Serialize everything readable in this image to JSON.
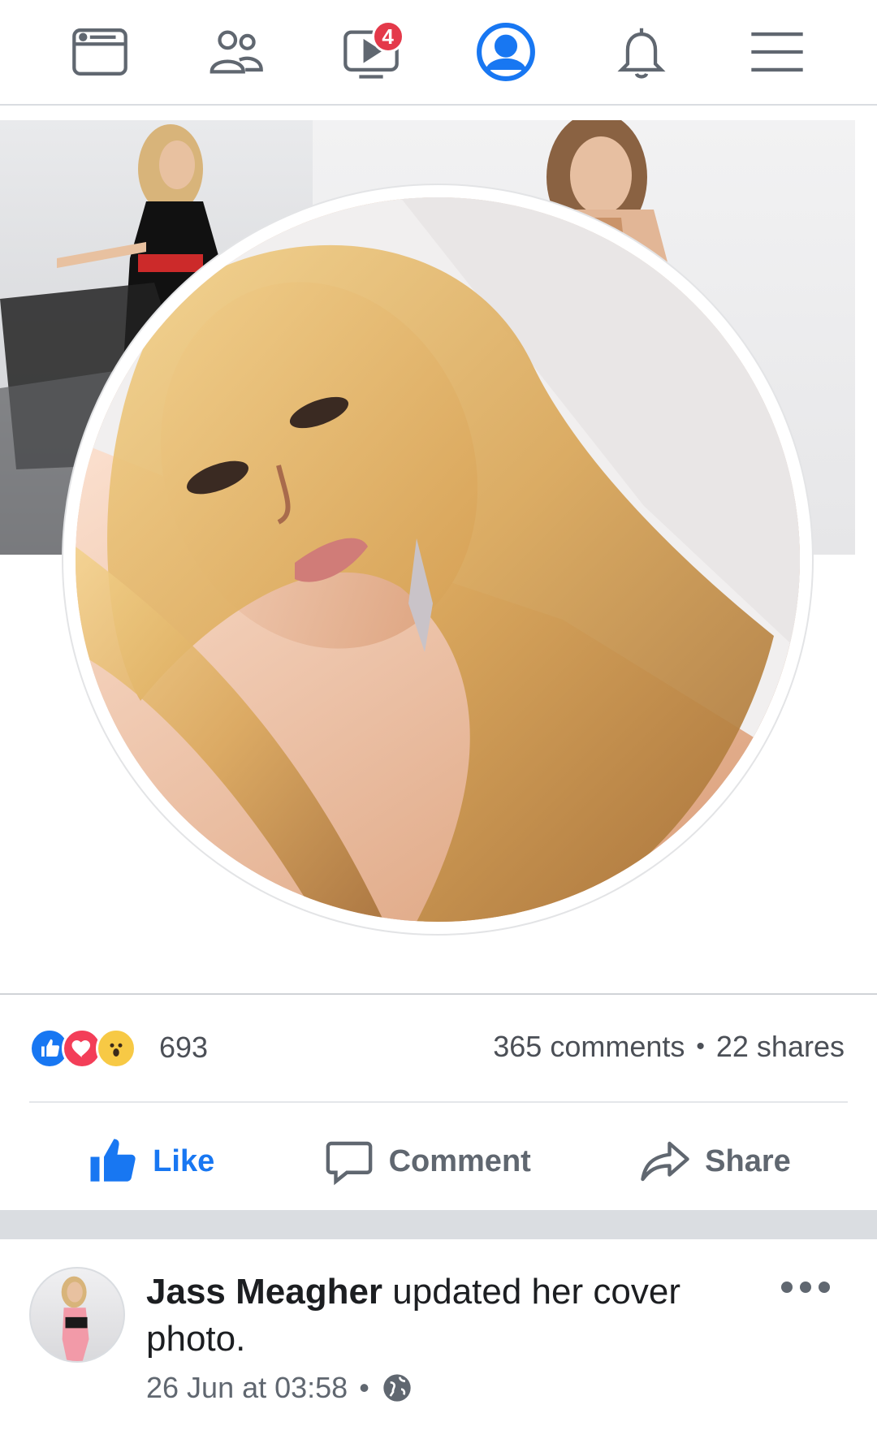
{
  "nav": {
    "items": [
      {
        "name": "news-feed",
        "icon": "news-feed-icon"
      },
      {
        "name": "friends",
        "icon": "friends-icon"
      },
      {
        "name": "watch",
        "icon": "video-icon",
        "badge": "4"
      },
      {
        "name": "profile",
        "icon": "profile-icon",
        "active": true
      },
      {
        "name": "notifications",
        "icon": "bell-icon"
      },
      {
        "name": "menu",
        "icon": "hamburger-menu-icon"
      }
    ],
    "active_color": "#1877f2",
    "badge_color": "#e4394a"
  },
  "reactions": {
    "icons": [
      "like-reaction-icon",
      "love-reaction-icon",
      "wow-reaction-icon"
    ],
    "count": "693"
  },
  "stats": {
    "comments": "365 comments",
    "separator": "•",
    "shares": "22 shares"
  },
  "actions": {
    "like": "Like",
    "comment": "Comment",
    "share": "Share"
  },
  "post": {
    "author": "Jass Meagher",
    "text": " updated her cover photo.",
    "timestamp": "26 Jun at 03:58",
    "separator": "•",
    "privacy_icon": "globe-icon"
  }
}
